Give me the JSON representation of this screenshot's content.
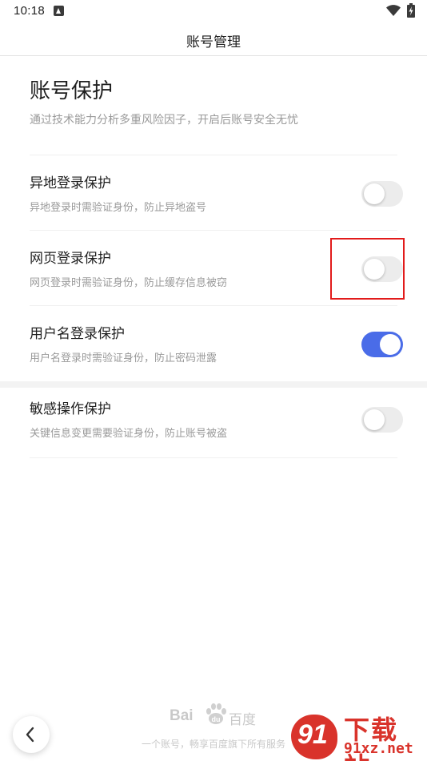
{
  "status_bar": {
    "time": "10:18",
    "icons": [
      "app-notification-icon",
      "wifi-icon",
      "battery-charging-icon"
    ]
  },
  "header": {
    "title": "账号管理"
  },
  "section": {
    "title": "账号保护",
    "description": "通过技术能力分析多重风险因子，开启后账号安全无忧"
  },
  "settings": [
    {
      "title": "异地登录保护",
      "description": "异地登录时需验证身份，防止异地盗号",
      "enabled": false
    },
    {
      "title": "网页登录保护",
      "description": "网页登录时需验证身份，防止缓存信息被窃",
      "enabled": false
    },
    {
      "title": "用户名登录保护",
      "description": "用户名登录时需验证身份，防止密码泄露",
      "enabled": true
    },
    {
      "title": "敏感操作保护",
      "description": "关键信息变更需要验证身份，防止账号被盗",
      "enabled": false
    }
  ],
  "footer": {
    "logo_latin_left": "Bai",
    "logo_latin_right": "du",
    "logo_cn": "百度",
    "tagline": "一个账号，畅享百度旗下所有服务"
  },
  "watermark": {
    "number": "91",
    "title": "下载站",
    "url": "91xz.net"
  },
  "colors": {
    "toggle_on": "#4a6ce8",
    "toggle_off": "#ececec",
    "highlight": "#e21b1b",
    "watermark": "#d9332b"
  }
}
